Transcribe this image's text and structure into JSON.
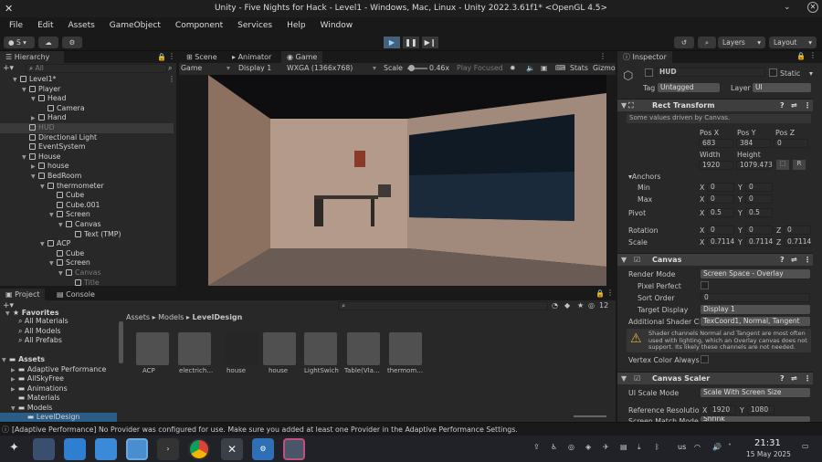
{
  "window": {
    "title": "Unity - Five Nights for Hack - Level1 - Windows, Mac, Linux - Unity 2022.3.61f1* <OpenGL 4.5>"
  },
  "menu": [
    "File",
    "Edit",
    "Assets",
    "GameObject",
    "Component",
    "Services",
    "Help",
    "Window"
  ],
  "toolbar": {
    "account": "S",
    "layers": "Layers",
    "layout": "Layout"
  },
  "hierarchy": {
    "tab": "Hierarchy",
    "search_placeholder": "All",
    "items": [
      {
        "label": "Level1*",
        "dim": false
      },
      {
        "label": "Player",
        "dim": false
      },
      {
        "label": "Head",
        "dim": false
      },
      {
        "label": "Camera",
        "dim": false
      },
      {
        "label": "Hand",
        "dim": false
      },
      {
        "label": "HUD",
        "dim": true
      },
      {
        "label": "Directional Light",
        "dim": false
      },
      {
        "label": "EventSystem",
        "dim": false
      },
      {
        "label": "House",
        "dim": false
      },
      {
        "label": "house",
        "dim": false
      },
      {
        "label": "BedRoom",
        "dim": false
      },
      {
        "label": "thermometer",
        "dim": false
      },
      {
        "label": "Cube",
        "dim": false
      },
      {
        "label": "Cube.001",
        "dim": false
      },
      {
        "label": "Screen",
        "dim": false
      },
      {
        "label": "Canvas",
        "dim": false
      },
      {
        "label": "Text (TMP)",
        "dim": false
      },
      {
        "label": "ACP",
        "dim": false
      },
      {
        "label": "Cube",
        "dim": false
      },
      {
        "label": "Screen",
        "dim": false
      },
      {
        "label": "Canvas",
        "dim": true
      },
      {
        "label": "Title",
        "dim": true
      }
    ]
  },
  "center_tabs": {
    "scene": "Scene",
    "animator": "Animator",
    "game": "Game"
  },
  "game_bar": {
    "mode": "Game",
    "display": "Display 1",
    "resolution": "WXGA (1366x768)",
    "scale_label": "Scale",
    "scale_value": "0.46x",
    "play_focused": "Play Focused",
    "stats": "Stats",
    "gizmos": "Gizmo"
  },
  "project": {
    "tab_project": "Project",
    "tab_console": "Console",
    "badge": "12",
    "favorites": "Favorites",
    "fav_items": [
      "All Materials",
      "All Models",
      "All Prefabs"
    ],
    "assets_root": "Assets",
    "folders": [
      "Adaptive Performance",
      "AllSkyFree",
      "Animations",
      "Materials",
      "Models",
      "LevelDesign"
    ],
    "breadcrumb": [
      "Assets",
      "Models",
      "LevelDesign"
    ],
    "assets": [
      "ACP",
      "electrich…",
      "house",
      "house",
      "LightSwich",
      "Table(Vla…",
      "thermom…"
    ]
  },
  "inspector": {
    "tab": "Inspector",
    "name": "HUD",
    "static": "Static",
    "tag_label": "Tag",
    "tag": "Untagged",
    "layer_label": "Layer",
    "layer": "UI",
    "rect": {
      "title": "Rect Transform",
      "note": "Some values driven by Canvas.",
      "posx_l": "Pos X",
      "posy_l": "Pos Y",
      "posz_l": "Pos Z",
      "posx": "683",
      "posy": "384",
      "posz": "0",
      "w_l": "Width",
      "h_l": "Height",
      "w": "1920",
      "h": "1079.473",
      "anchors": "Anchors",
      "min": "Min",
      "max": "Max",
      "pivot": "Pivot",
      "rotation": "Rotation",
      "scale": "Scale",
      "x": "X",
      "y": "Y",
      "z": "Z",
      "min_x": "0",
      "min_y": "0",
      "max_x": "0",
      "max_y": "0",
      "pivot_x": "0.5",
      "pivot_y": "0.5",
      "rot_x": "0",
      "rot_y": "0",
      "rot_z": "0",
      "sc_x": "0.7114",
      "sc_y": "0.7114",
      "sc_z": "0.7114",
      "r_btn": "R"
    },
    "canvas": {
      "title": "Canvas",
      "render_mode_l": "Render Mode",
      "render_mode": "Screen Space - Overlay",
      "pixel_perfect": "Pixel Perfect",
      "sort_order_l": "Sort Order",
      "sort_order": "0",
      "target_display_l": "Target Display",
      "target_display": "Display 1",
      "shader_l": "Additional Shader Ch",
      "shader": "TexCoord1, Normal, Tangent",
      "warning": "Shader channels Normal and Tangent are most often used with lighting, which an Overlay canvas does not support. Its likely these channels are not needed.",
      "vertex_color": "Vertex Color Always I"
    },
    "scaler": {
      "title": "Canvas Scaler",
      "ui_scale_l": "UI Scale Mode",
      "ui_scale": "Scale With Screen Size",
      "ref_l": "Reference Resolution",
      "ref_x_l": "X",
      "ref_x": "1920",
      "ref_y_l": "Y",
      "ref_y": "1080",
      "match_l": "Screen Match Mode",
      "match": "Shrink"
    }
  },
  "status": {
    "message": "[Adaptive Performance] No Provider was configured for use. Make sure you added at least one Provider in the Adaptive Performance Settings."
  },
  "taskbar": {
    "lang": "us",
    "time": "21:31",
    "date": "15 May 2025"
  }
}
